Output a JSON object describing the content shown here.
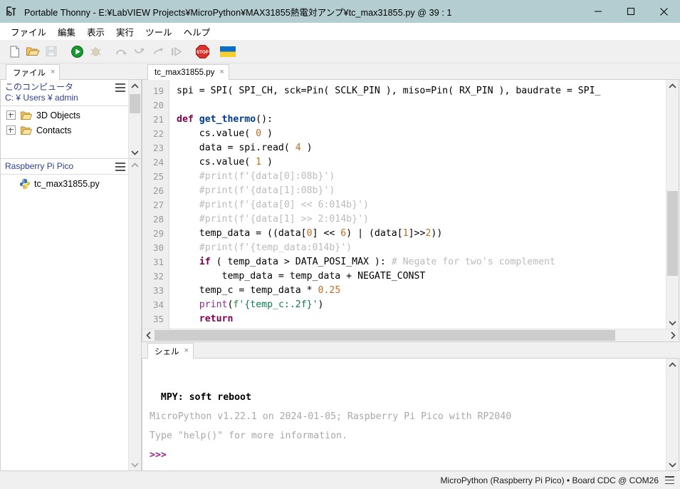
{
  "window": {
    "title": "Portable Thonny  -  E:¥LabVIEW Projects¥MicroPython¥MAX31855熱電対アンプ¥tc_max31855.py  @  39 : 1",
    "app_icon": "thonny-icon",
    "titlebar_color": "#b3cdd1",
    "minimize_label": "─",
    "maximize_label": "□",
    "close_label": "✕"
  },
  "menubar": {
    "items": [
      {
        "label": "ファイル",
        "name": "menu-file"
      },
      {
        "label": "編集",
        "name": "menu-edit"
      },
      {
        "label": "表示",
        "name": "menu-view"
      },
      {
        "label": "実行",
        "name": "menu-run"
      },
      {
        "label": "ツール",
        "name": "menu-tools"
      },
      {
        "label": "ヘルプ",
        "name": "menu-help"
      }
    ]
  },
  "toolbar": {
    "buttons": [
      {
        "name": "new-file-button",
        "icon": "new-file-icon",
        "enabled": true
      },
      {
        "name": "open-file-button",
        "icon": "open-folder-icon",
        "enabled": true
      },
      {
        "name": "save-file-button",
        "icon": "save-disk-icon",
        "enabled": false
      },
      {
        "name": "run-button",
        "icon": "run-play-icon",
        "enabled": true
      },
      {
        "name": "debug-button",
        "icon": "debug-bug-icon",
        "enabled": false
      },
      {
        "name": "step-over-button",
        "icon": "step-over-icon",
        "enabled": false
      },
      {
        "name": "step-into-button",
        "icon": "step-into-icon",
        "enabled": false
      },
      {
        "name": "step-out-button",
        "icon": "step-out-icon",
        "enabled": false
      },
      {
        "name": "resume-button",
        "icon": "resume-icon",
        "enabled": false
      },
      {
        "name": "stop-button",
        "icon": "stop-sign-icon",
        "enabled": true
      },
      {
        "name": "ukraine-flag-button",
        "icon": "ukraine-flag-icon",
        "enabled": true
      }
    ]
  },
  "sidebar": {
    "tab": {
      "label": "ファイル",
      "close": "×"
    },
    "computer_panel": {
      "title": "このコンピュータ",
      "path": "C: ¥ Users ¥ admin",
      "menu_icon": "hamburger-icon",
      "items": [
        {
          "label": "3D Objects",
          "icon": "folder-icon"
        },
        {
          "label": "Contacts",
          "icon": "folder-icon"
        }
      ]
    },
    "device_panel": {
      "title": "Raspberry Pi Pico",
      "menu_icon": "hamburger-icon",
      "items": [
        {
          "label": "tc_max31855.py",
          "icon": "python-file-icon"
        }
      ]
    }
  },
  "editor": {
    "tab": {
      "label": "tc_max31855.py",
      "close": "×"
    },
    "line_numbers": [
      19,
      20,
      21,
      22,
      23,
      24,
      25,
      26,
      27,
      28,
      29,
      30,
      31,
      32,
      33,
      34,
      35
    ],
    "lines": [
      {
        "n": 19,
        "tokens": [
          {
            "t": "spi = SPI( SPI_CH, sck=Pin( SCLK_PIN ), miso=Pin( RX_PIN ), baudrate = SPI_",
            "c": "plain"
          }
        ]
      },
      {
        "n": 20,
        "tokens": []
      },
      {
        "n": 21,
        "tokens": [
          {
            "t": "def ",
            "c": "kw"
          },
          {
            "t": "get_thermo",
            "c": "fn"
          },
          {
            "t": "():",
            "c": "plain"
          }
        ]
      },
      {
        "n": 22,
        "tokens": [
          {
            "t": "    cs.value( ",
            "c": "plain"
          },
          {
            "t": "0",
            "c": "num"
          },
          {
            "t": " )",
            "c": "plain"
          }
        ]
      },
      {
        "n": 23,
        "tokens": [
          {
            "t": "    data = spi.read( ",
            "c": "plain"
          },
          {
            "t": "4",
            "c": "num"
          },
          {
            "t": " )",
            "c": "plain"
          }
        ]
      },
      {
        "n": 24,
        "tokens": [
          {
            "t": "    cs.value( ",
            "c": "plain"
          },
          {
            "t": "1",
            "c": "num"
          },
          {
            "t": " )",
            "c": "plain"
          }
        ]
      },
      {
        "n": 25,
        "tokens": [
          {
            "t": "    #print(f'{data[0]:08b}')",
            "c": "cmt"
          }
        ]
      },
      {
        "n": 26,
        "tokens": [
          {
            "t": "    #print(f'{data[1]:08b}')",
            "c": "cmt"
          }
        ]
      },
      {
        "n": 27,
        "tokens": [
          {
            "t": "    #print(f'{data[0] << 6:014b}')",
            "c": "cmt"
          }
        ]
      },
      {
        "n": 28,
        "tokens": [
          {
            "t": "    #print(f'{data[1] >> 2:014b}')",
            "c": "cmt"
          }
        ]
      },
      {
        "n": 29,
        "tokens": [
          {
            "t": "    temp_data = ((data[",
            "c": "plain"
          },
          {
            "t": "0",
            "c": "num"
          },
          {
            "t": "] << ",
            "c": "plain"
          },
          {
            "t": "6",
            "c": "num"
          },
          {
            "t": ") | (data[",
            "c": "plain"
          },
          {
            "t": "1",
            "c": "num"
          },
          {
            "t": "]>>",
            "c": "plain"
          },
          {
            "t": "2",
            "c": "num"
          },
          {
            "t": "))",
            "c": "plain"
          }
        ]
      },
      {
        "n": 30,
        "tokens": [
          {
            "t": "    #print(f'{temp_data:014b}')",
            "c": "cmt"
          }
        ]
      },
      {
        "n": 31,
        "tokens": [
          {
            "t": "    ",
            "c": "plain"
          },
          {
            "t": "if",
            "c": "kw"
          },
          {
            "t": " ( temp_data > DATA_POSI_MAX ):",
            "c": "plain"
          },
          {
            "t": " # Negate for two's complement",
            "c": "cmt"
          }
        ]
      },
      {
        "n": 32,
        "tokens": [
          {
            "t": "        temp_data = temp_data + NEGATE_CONST",
            "c": "plain"
          }
        ]
      },
      {
        "n": 33,
        "tokens": [
          {
            "t": "    temp_c = temp_data * ",
            "c": "plain"
          },
          {
            "t": "0.25",
            "c": "num"
          }
        ]
      },
      {
        "n": 34,
        "tokens": [
          {
            "t": "    ",
            "c": "plain"
          },
          {
            "t": "print",
            "c": "bi"
          },
          {
            "t": "(",
            "c": "plain"
          },
          {
            "t": "f'",
            "c": "str"
          },
          {
            "t": "{temp_c:.2f}",
            "c": "strf"
          },
          {
            "t": "'",
            "c": "str"
          },
          {
            "t": ")",
            "c": "plain"
          }
        ]
      },
      {
        "n": 35,
        "tokens": [
          {
            "t": "    ",
            "c": "plain"
          },
          {
            "t": "return",
            "c": "kw"
          }
        ]
      }
    ]
  },
  "shell": {
    "tab": {
      "label": "シェル",
      "close": "×"
    },
    "lines": [
      {
        "text": "",
        "style": "sh-gray"
      },
      {
        "text": "  MPY: soft reboot",
        "style": "sh-bold"
      },
      {
        "text": "MicroPython v1.22.1 on 2024-01-05; Raspberry Pi Pico with RP2040",
        "style": "sh-gray"
      },
      {
        "text": "Type \"help()\" for more information.",
        "style": "sh-gray"
      },
      {
        "text": ">>>",
        "style": "sh-prompt"
      }
    ]
  },
  "statusbar": {
    "text": "MicroPython (Raspberry Pi Pico)  •  Board CDC @ COM26",
    "menu_icon": "hamburger-icon"
  },
  "scrollbars": {
    "editor_v": {
      "thumb_top_pct": 44,
      "thumb_height_pct": 38
    },
    "editor_h": {
      "thumb_left_pct": 0,
      "thumb_width_pct": 90
    },
    "computer_v": {
      "thumb_top_pct": 5,
      "thumb_height_pct": 38
    },
    "device_v": {
      "thumb_top_pct": 0,
      "thumb_height_pct": 0
    },
    "shell_v": {
      "thumb_top_pct": 0,
      "thumb_height_pct": 0
    }
  },
  "colors": {
    "titlebar": "#b3cdd1",
    "keyword": "#7f0055",
    "function": "#003a8c",
    "number": "#c46a1c",
    "comment": "#bbbbbb",
    "string": "#138f3b",
    "panel_title": "#2f3f8f",
    "prompt": "#9b1f87"
  }
}
